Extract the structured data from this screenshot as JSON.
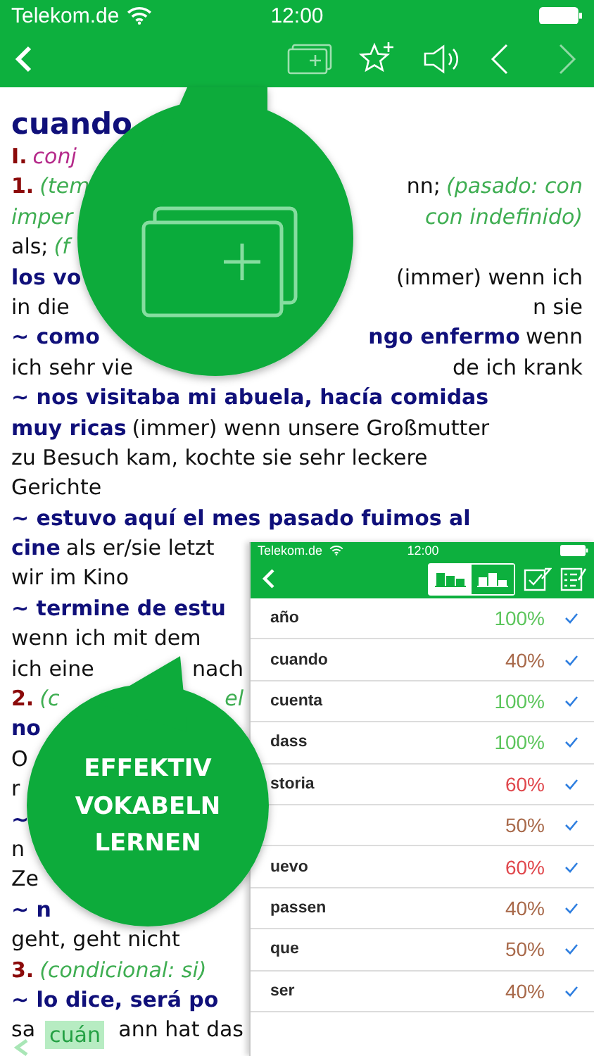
{
  "status_bar": {
    "carrier": "Telekom.de",
    "time": "12:00"
  },
  "toolbar": {
    "previous_button": {
      "disabled": false
    },
    "next_button": {
      "disabled": true
    }
  },
  "entry": {
    "lines": [
      {
        "left": [
          {
            "kind": "headword",
            "text": "cuando"
          }
        ]
      },
      {
        "left": [
          {
            "kind": "number",
            "text": "I."
          },
          {
            "kind": "pos",
            "text": "conj"
          }
        ]
      },
      {
        "left": [
          {
            "kind": "number",
            "text": "1."
          },
          {
            "kind": "note",
            "text": "(tem"
          }
        ],
        "right": [
          {
            "kind": "translation",
            "text": "nn;"
          },
          {
            "kind": "note",
            "text": "(pasado: con"
          }
        ]
      },
      {
        "left": [
          {
            "kind": "note",
            "text": "imper"
          }
        ],
        "right": [
          {
            "kind": "note",
            "text": "con indefinido)"
          }
        ]
      },
      {
        "left": [
          {
            "kind": "translation",
            "text": "als;"
          },
          {
            "kind": "note",
            "text": "(f"
          }
        ]
      },
      {
        "left": [
          {
            "kind": "phrase",
            "text": "los vo"
          }
        ],
        "right": [
          {
            "kind": "translation",
            "text": "(immer) wenn ich"
          }
        ]
      },
      {
        "left": [
          {
            "kind": "translation",
            "text": "in die"
          }
        ],
        "right": [
          {
            "kind": "translation",
            "text": "n sie"
          }
        ]
      },
      {
        "left": [
          {
            "kind": "phrase",
            "text": "~ como"
          }
        ],
        "right": [
          {
            "kind": "phrase",
            "text": "ngo enfermo"
          },
          {
            "kind": "translation",
            "text": "wenn"
          }
        ]
      },
      {
        "left": [
          {
            "kind": "translation",
            "text": "ich sehr vie"
          }
        ],
        "right": [
          {
            "kind": "translation",
            "text": "de ich krank"
          }
        ]
      },
      {
        "left": [
          {
            "kind": "phrase",
            "text": "~ nos visitaba mi abuela, hacía comidas"
          }
        ]
      },
      {
        "left": [
          {
            "kind": "phrase",
            "text": "muy ricas"
          },
          {
            "kind": "translation",
            "text": "(immer) wenn unsere Großmutter"
          }
        ]
      },
      {
        "left": [
          {
            "kind": "translation",
            "text": "zu Besuch kam, kochte sie sehr leckere"
          }
        ]
      },
      {
        "left": [
          {
            "kind": "translation",
            "text": "Gerichte"
          }
        ]
      },
      {
        "left": [
          {
            "kind": "phrase",
            "text": "~ estuvo aquí el mes pasado fuimos al"
          }
        ]
      },
      {
        "left": [
          {
            "kind": "phrase",
            "text": "cine"
          },
          {
            "kind": "translation",
            "text": "als er/sie letzt"
          }
        ]
      },
      {
        "left": [
          {
            "kind": "translation",
            "text": "wir im Kino"
          }
        ]
      },
      {
        "left": [
          {
            "kind": "phrase",
            "text": "~ termine de estu"
          }
        ]
      },
      {
        "left": [
          {
            "kind": "translation",
            "text": "wenn ich mit dem"
          }
        ]
      },
      {
        "left": [
          {
            "kind": "translation",
            "text": "ich eine"
          }
        ],
        "right": [
          {
            "kind": "translation",
            "text": "nach"
          }
        ]
      },
      {
        "left": [
          {
            "kind": "number",
            "text": "2."
          },
          {
            "kind": "note",
            "text": "(c"
          }
        ],
        "right": [
          {
            "kind": "note",
            "text": "el"
          }
        ]
      },
      {
        "left": [
          {
            "kind": "phrase",
            "text": "no"
          }
        ]
      },
      {
        "left": [
          {
            "kind": "translation",
            "text": "O"
          }
        ]
      },
      {
        "left": [
          {
            "kind": "translation",
            "text": "r"
          }
        ]
      },
      {
        "left": [
          {
            "kind": "phrase",
            "text": "~"
          }
        ]
      },
      {
        "left": [
          {
            "kind": "translation",
            "text": "n"
          }
        ]
      },
      {
        "left": [
          {
            "kind": "translation",
            "text": "Ze"
          }
        ]
      },
      {
        "left": [
          {
            "kind": "phrase",
            "text": "~ n"
          }
        ]
      },
      {
        "left": [
          {
            "kind": "translation",
            "text": "geht, geht nicht"
          }
        ]
      },
      {
        "left": [
          {
            "kind": "number",
            "text": "3."
          },
          {
            "kind": "note",
            "text": "(condicional: si)"
          }
        ]
      },
      {
        "left": [
          {
            "kind": "phrase",
            "text": "~ lo dice, será po"
          }
        ]
      },
      {
        "left": [
          {
            "kind": "translation",
            "text": "sa"
          }
        ],
        "right": [
          {
            "kind": "translation",
            "text": "ann hat das"
          }
        ]
      }
    ]
  },
  "suggestion": {
    "text": "cuán"
  },
  "callout": {
    "text": "EFFEKTIV VOKABELN LERNEN"
  },
  "vocab_panel": {
    "status_bar": {
      "carrier": "Telekom.de",
      "time": "12:00"
    },
    "sort_options": [
      {
        "selected": true
      },
      {
        "selected": false
      }
    ],
    "rows": [
      {
        "word": "año",
        "score": "100%",
        "color": "#5cc55c",
        "checked": true
      },
      {
        "word": "cuando",
        "score": "40%",
        "color": "#a8694a",
        "checked": true
      },
      {
        "word": "cuenta",
        "score": "100%",
        "color": "#5cc55c",
        "checked": true
      },
      {
        "word": "dass",
        "score": "100%",
        "color": "#5cc55c",
        "checked": true
      },
      {
        "word": "storia",
        "score": "60%",
        "color": "#e0474c",
        "checked": true
      },
      {
        "score": "50%",
        "color": "#a8694a",
        "checked": true
      },
      {
        "word": "uevo",
        "score": "60%",
        "color": "#e0474c",
        "checked": true
      },
      {
        "word": "passen",
        "score": "40%",
        "color": "#a8694a",
        "checked": true
      },
      {
        "word": "que",
        "score": "50%",
        "color": "#a8694a",
        "checked": true
      },
      {
        "word": "ser",
        "score": "40%",
        "color": "#a8694a",
        "checked": true
      }
    ]
  }
}
